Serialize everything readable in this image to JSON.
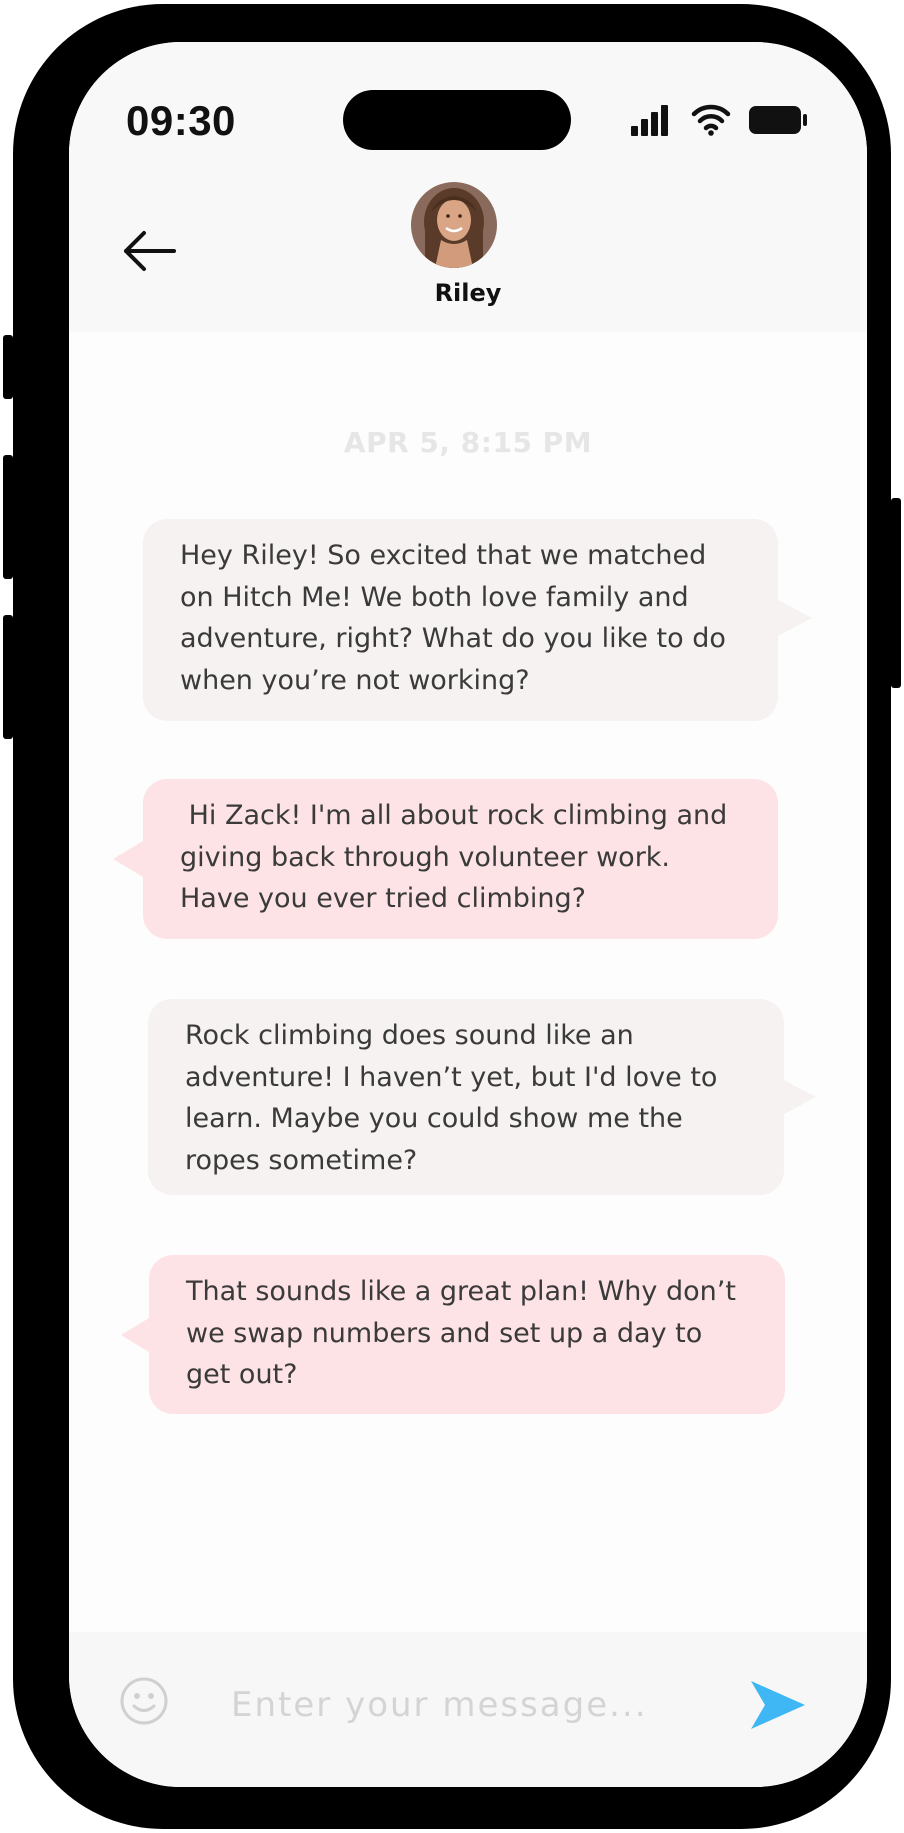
{
  "status_bar": {
    "time": "09:30",
    "icons": [
      "cellular-signal-icon",
      "wifi-icon",
      "battery-icon"
    ]
  },
  "header": {
    "back_icon": "arrow-left-icon",
    "contact_name": "Riley"
  },
  "chat": {
    "date_stamp": "APR 5, 8:15 PM",
    "messages": [
      {
        "direction": "sent",
        "text": "Hey Riley! So excited that we matched on Hitch Me! We both love family and adventure, right? What do you like to do when you’re not working?"
      },
      {
        "direction": "received",
        "text": " Hi Zack! I'm all about rock climbing and giving back through volunteer work. Have you ever tried climbing?"
      },
      {
        "direction": "sent",
        "text": "Rock climbing does sound like an adventure! I haven’t yet, but I'd love to learn. Maybe you could show me the ropes sometime?"
      },
      {
        "direction": "received",
        "text": "That sounds like a great plan! Why don’t we swap numbers and set up a day to get out?"
      }
    ]
  },
  "composer": {
    "emoji_icon": "smiley-face-icon",
    "placeholder": "Enter your message...",
    "value": "",
    "send_icon": "send-arrow-icon"
  },
  "colors": {
    "sent_bubble": "#f7f2f2",
    "received_bubble": "#fde3e5",
    "send_accent": "#3fb7f5",
    "date_stamp": "#e6e6e6"
  }
}
